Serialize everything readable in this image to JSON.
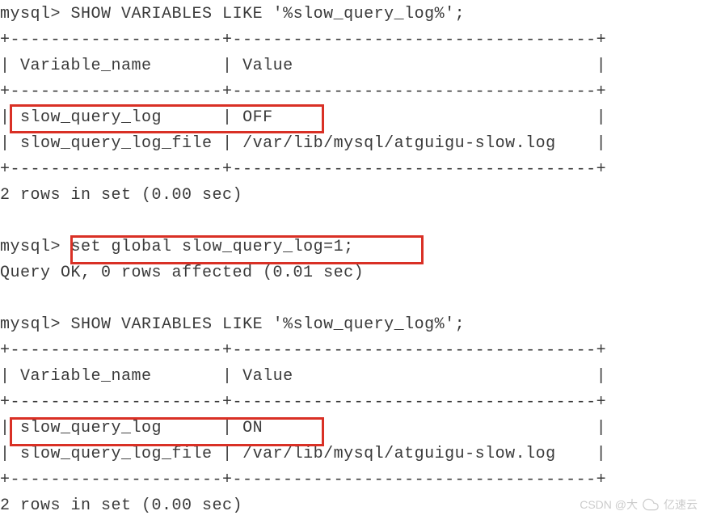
{
  "terminal": {
    "prompt": "mysql>",
    "query1": {
      "command": "SHOW VARIABLES LIKE '%slow_query_log%';",
      "divider": "+---------------------+------------------------------------+",
      "header_variable": "Variable_name",
      "header_value": "Value",
      "rows": [
        {
          "variable": "slow_query_log",
          "value": "OFF"
        },
        {
          "variable": "slow_query_log_file",
          "value": "/var/lib/mysql/atguigu-slow.log"
        }
      ],
      "result": "2 rows in set (0.00 sec)"
    },
    "query2": {
      "command": "set global slow_query_log=1;",
      "result": "Query OK, 0 rows affected (0.01 sec)"
    },
    "query3": {
      "command": "SHOW VARIABLES LIKE '%slow_query_log%';",
      "divider": "+---------------------+------------------------------------+",
      "header_variable": "Variable_name",
      "header_value": "Value",
      "rows": [
        {
          "variable": "slow_query_log",
          "value": "ON"
        },
        {
          "variable": "slow_query_log_file",
          "value": "/var/lib/mysql/atguigu-slow.log"
        }
      ],
      "result": "2 rows in set (0.00 sec)"
    }
  },
  "watermark": {
    "text1": "CSDN @大",
    "text2": "亿速云"
  }
}
